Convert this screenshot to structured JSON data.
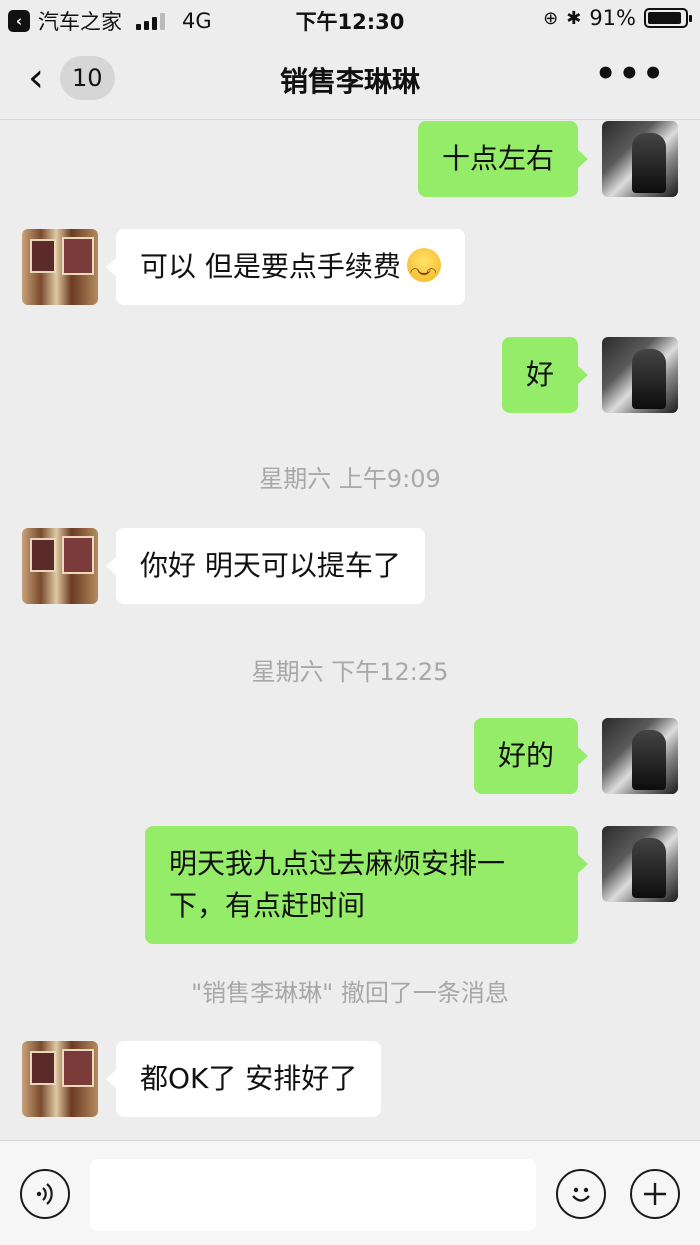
{
  "status_bar": {
    "back_app": "汽车之家",
    "network": "4G",
    "time": "下午12:30",
    "battery": "91%",
    "battery_level": 0.91
  },
  "nav": {
    "back_count": "10",
    "title": "销售李琳琳",
    "more": "•••"
  },
  "messages": [
    {
      "side": "me",
      "text": "十点左右"
    },
    {
      "side": "other",
      "text": "可以 但是要点手续费",
      "emoji": "smile-emoji"
    },
    {
      "side": "me",
      "text": "好"
    },
    {
      "side": "time",
      "text": "星期六 上午9:09"
    },
    {
      "side": "other",
      "text": "你好 明天可以提车了"
    },
    {
      "side": "time",
      "text": "星期六 下午12:25"
    },
    {
      "side": "me",
      "text": "好的"
    },
    {
      "side": "me",
      "text": "明天我九点过去麻烦安排一下，有点赶时间"
    },
    {
      "side": "recall",
      "text": "\"销售李琳琳\" 撤回了一条消息"
    },
    {
      "side": "other",
      "text": "都OK了 安排好了"
    }
  ],
  "input": {
    "placeholder": ""
  },
  "icons": {
    "voice": "voice-icon",
    "emoji": "emoji-icon",
    "plus": "plus-icon"
  }
}
